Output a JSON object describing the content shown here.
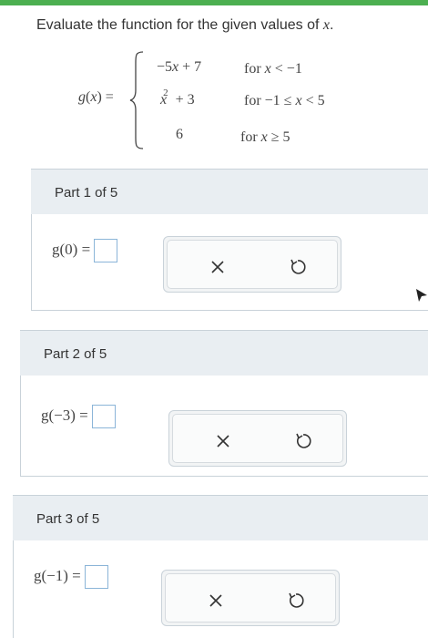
{
  "prompt": {
    "text": "Evaluate the function for the given values of ",
    "variable": "x",
    "end": "."
  },
  "function": {
    "lhs": "g(x) =",
    "cases": [
      {
        "expression": "−5x + 7",
        "condition": "for x < −1"
      },
      {
        "expression": "x² + 3",
        "condition": "for −1 ≤ x < 5"
      },
      {
        "expression": "6",
        "condition": "for x ≥ 5"
      }
    ]
  },
  "parts": [
    {
      "label": "Part 1 of 5",
      "expression": "g(0) ="
    },
    {
      "label": "Part 2 of 5",
      "expression": "g(−3) ="
    },
    {
      "label": "Part 3 of 5",
      "expression": "g(−1) ="
    }
  ],
  "buttons": {
    "clear_symbol": "×",
    "undo_icon": "undo-icon"
  },
  "colors": {
    "accent_bar": "#4caf50",
    "answer_box_border": "#8bb5d8",
    "part_header_bg": "#e9eef2"
  }
}
